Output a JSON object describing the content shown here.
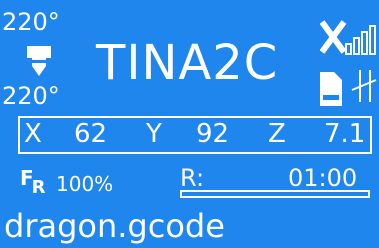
{
  "status": {
    "hotend_target_temp": "220°",
    "hotend_current_temp": "220°",
    "printer_name": "TINA2C",
    "wifi_status": "disconnected",
    "storage_icon": "sd-card-icon",
    "connection_icon": "usb-icon"
  },
  "position": {
    "x_label": "X",
    "x_value": "62",
    "y_label": "Y",
    "y_value": "92",
    "z_label": "Z",
    "z_value": "7.1"
  },
  "print": {
    "feedrate_label_f": "F",
    "feedrate_label_r": "R",
    "feedrate_percent": "100%",
    "remaining_label": "R:",
    "time": "01:00",
    "progress": 0,
    "filename": "dragon.gcode"
  },
  "colors": {
    "background": "#1f86ee",
    "foreground": "#ffffff"
  }
}
